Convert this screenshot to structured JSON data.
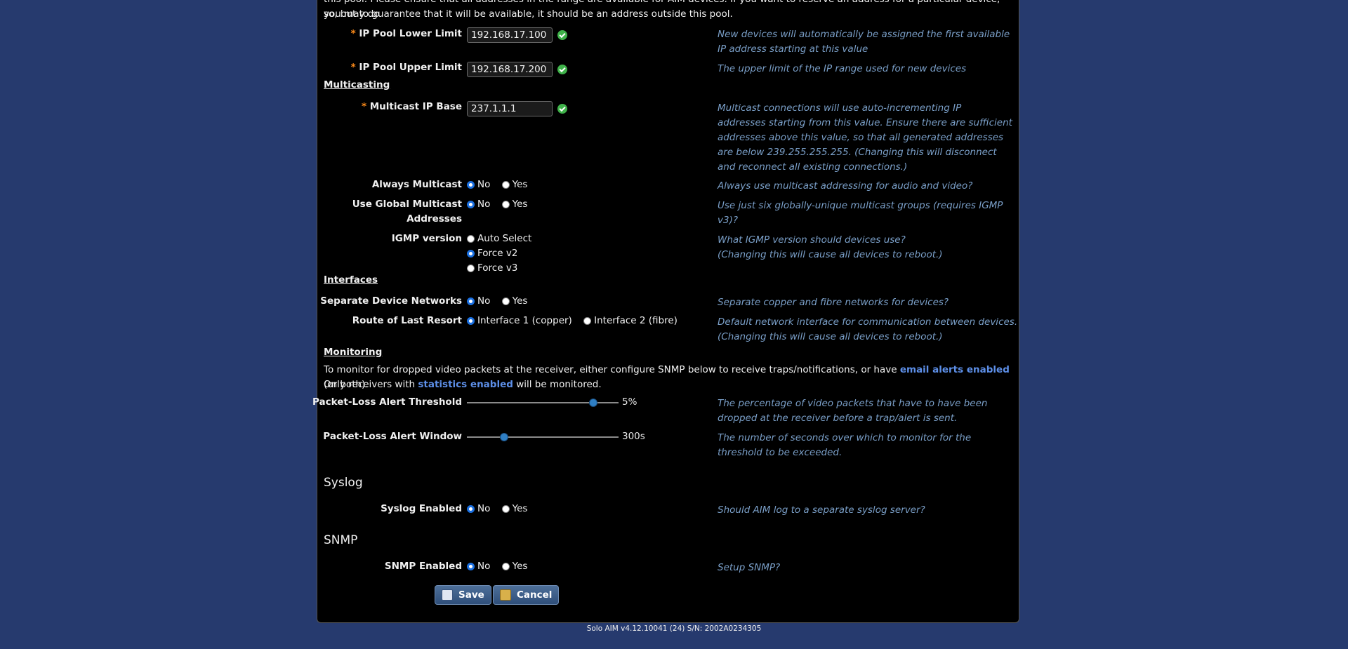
{
  "intro": {
    "line1": "this pool. Please ensure that all addresses in the range are available for AIM devices. If you want to reserve an address for a particular device, you may do",
    "line2": "so, but to guarantee that it will be available, it should be an address outside this pool."
  },
  "ip_pool": {
    "lower_label": "IP Pool Lower Limit",
    "lower_value": "192.168.17.100",
    "lower_help": "New devices will automatically be assigned the first available IP address starting at this value",
    "upper_label": "IP Pool Upper Limit",
    "upper_value": "192.168.17.200",
    "upper_help": "The upper limit of the IP range used for new devices"
  },
  "multicasting": {
    "title": "Multicasting",
    "base_label": "Multicast IP Base",
    "base_value": "237.1.1.1",
    "base_help": "Multicast connections will use auto-incrementing IP addresses starting from this value. Ensure there are sufficient addresses above this value, so that all generated addresses are below 239.255.255.255. (Changing this will disconnect and reconnect all existing connections.)",
    "always_label": "Always Multicast",
    "always_help": "Always use multicast addressing for audio and video?",
    "global_label_1": "Use Global Multicast",
    "global_label_2": "Addresses",
    "global_help": "Use just six globally-unique multicast groups (requires IGMP v3)?",
    "igmp_label": "IGMP version",
    "igmp_options": [
      "Auto Select",
      "Force v2",
      "Force v3"
    ],
    "igmp_help_1": "What IGMP version should devices use?",
    "igmp_help_2": "(Changing this will cause all devices to reboot.)"
  },
  "common": {
    "no": "No",
    "yes": "Yes",
    "required_mark": "*"
  },
  "interfaces": {
    "title": "Interfaces",
    "separate_label": "Separate Device Networks",
    "separate_help": "Separate copper and fibre networks for devices?",
    "route_label": "Route of Last Resort",
    "route_opt1": "Interface 1 (copper)",
    "route_opt2": "Interface 2 (fibre)",
    "route_help_1": "Default network interface for communication between devices.",
    "route_help_2": "(Changing this will cause all devices to reboot.)"
  },
  "monitoring": {
    "title": "Monitoring",
    "text_a": "To monitor for dropped video packets at the receiver, either configure SNMP below to receive traps/notifications, or have",
    "link_email": "email alerts enabled",
    "text_b": "(or both).",
    "text_c": "Only receivers with",
    "link_stats": "statistics enabled",
    "text_d": "will be monitored.",
    "threshold_label": "Packet-Loss Alert Threshold",
    "threshold_value": "5%",
    "threshold_fraction": 0.83,
    "threshold_help": "The percentage of video packets that have to have been dropped at the receiver before a trap/alert is sent.",
    "window_label": "Packet-Loss Alert Window",
    "window_value": "300s",
    "window_fraction": 0.24,
    "window_help": "The number of seconds over which to monitor for the threshold to be exceeded."
  },
  "syslog": {
    "title": "Syslog",
    "enabled_label": "Syslog Enabled",
    "help": "Should AIM log to a separate syslog server?"
  },
  "snmp": {
    "title": "SNMP",
    "enabled_label": "SNMP Enabled",
    "help": "Setup SNMP?"
  },
  "buttons": {
    "save": "Save",
    "cancel": "Cancel"
  },
  "footer": "Solo AIM v4.12.10041 (24)  S/N: 2002A0234305"
}
